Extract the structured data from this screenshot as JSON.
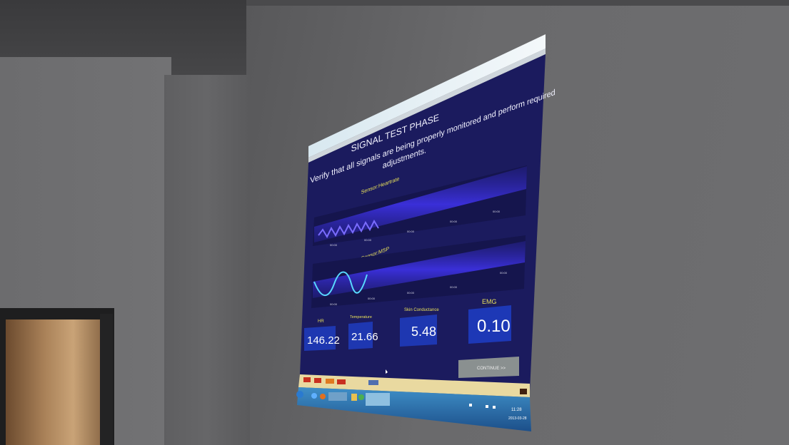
{
  "window": {
    "title_bar_text": "",
    "menu_items": [
      "",
      "",
      ""
    ]
  },
  "app": {
    "phase_title": "SIGNAL TEST PHASE",
    "instruction_line1": "Verify that all signals are being properly monitored and perform required",
    "instruction_line2": "adjustments.",
    "panel1_label": "Sensor:Heartrate",
    "panel2_label": "Sensor:MSP",
    "metrics": [
      {
        "label": "HR",
        "value": "146.22"
      },
      {
        "label": "Temperature",
        "value": "21.66"
      },
      {
        "label": "Skin Conductance",
        "value": "5.48"
      },
      {
        "label": "EMG",
        "value": "0.10"
      }
    ],
    "continue_label": "CONTINUE >>"
  },
  "taskbar": {
    "clock_time": "11:28",
    "clock_date": "2013-03-28"
  },
  "colors": {
    "screen_bg": "#1d1d66",
    "signal_band": "#3a2fd8",
    "metric_box": "#1e3cc0",
    "label_yellow": "#e8e05a",
    "title_white": "#f2f2ff",
    "button_gray": "#8a9090",
    "trace_color": "#58d8ff"
  },
  "icons": [
    "start-orb-icon",
    "ie-icon",
    "firefox-icon",
    "folder-icon",
    "chrome-icon",
    "network-icon",
    "volume-icon",
    "flag-icon"
  ]
}
